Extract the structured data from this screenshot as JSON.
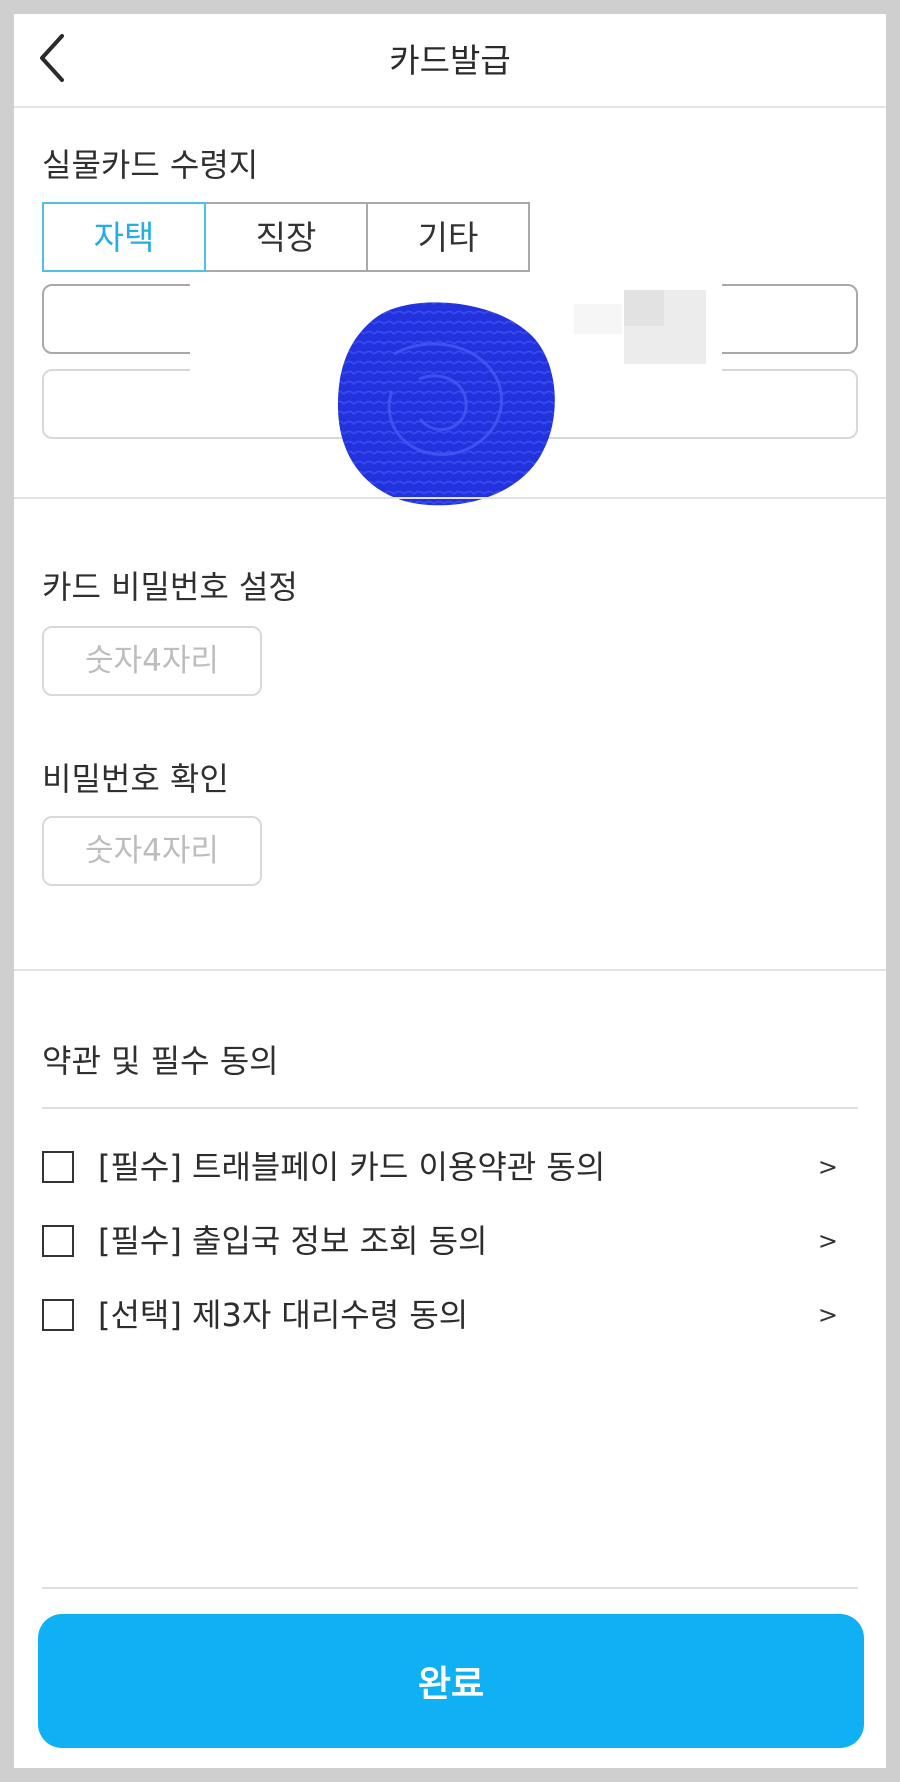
{
  "header": {
    "title": "카드발급"
  },
  "pickup": {
    "title": "실물카드 수령지",
    "tabs": [
      "자택",
      "직장",
      "기타"
    ],
    "active_tab": "자택"
  },
  "pin": {
    "title": "카드 비밀번호 설정",
    "placeholder": "숫자4자리"
  },
  "pin_confirm": {
    "title": "비밀번호 확인",
    "placeholder": "숫자4자리"
  },
  "terms": {
    "title": "약관 및 필수 동의",
    "items": [
      {
        "label": "[필수] 트래블페이 카드 이용약관 동의",
        "arrow": ">"
      },
      {
        "label": "[필수] 출입국 정보 조회 동의",
        "arrow": ">"
      },
      {
        "label": "[선택] 제3자 대리수령 동의",
        "arrow": ">"
      }
    ]
  },
  "submit": {
    "label": "완료"
  },
  "colors": {
    "accent": "#10b0f5",
    "active_tab_text": "#24aee2",
    "scribble": "#2233dd"
  },
  "icons": {
    "back": "chevron-left-icon",
    "item_arrow": "chevron-right-icon"
  }
}
